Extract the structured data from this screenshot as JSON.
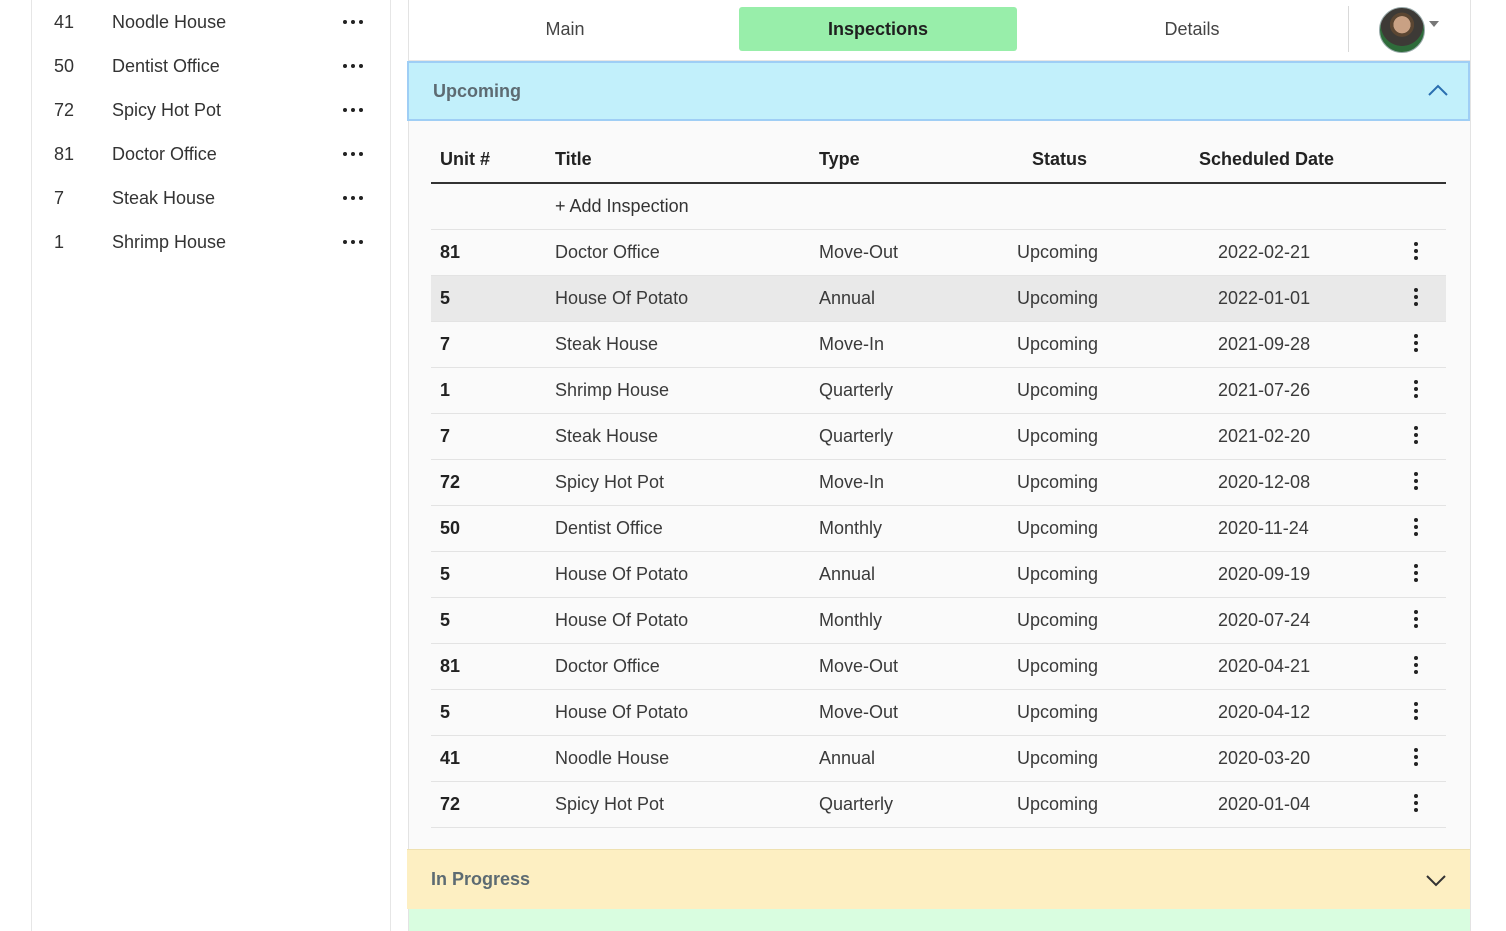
{
  "sidebar": {
    "items": [
      {
        "unit": "41",
        "title": "Noodle House"
      },
      {
        "unit": "50",
        "title": "Dentist Office"
      },
      {
        "unit": "72",
        "title": "Spicy Hot Pot"
      },
      {
        "unit": "81",
        "title": "Doctor Office"
      },
      {
        "unit": "7",
        "title": "Steak House"
      },
      {
        "unit": "1",
        "title": "Shrimp House"
      }
    ]
  },
  "tabs": {
    "main": "Main",
    "inspections": "Inspections",
    "details": "Details"
  },
  "sections": {
    "upcoming": "Upcoming",
    "in_progress": "In Progress"
  },
  "table": {
    "headers": {
      "unit": "Unit #",
      "title": "Title",
      "type": "Type",
      "status": "Status",
      "date": "Scheduled Date"
    },
    "add_label": "+  Add Inspection",
    "rows": [
      {
        "unit": "81",
        "title": "Doctor Office",
        "type": "Move-Out",
        "status": "Upcoming",
        "date": "2022-02-21"
      },
      {
        "unit": "5",
        "title": "House Of Potato",
        "type": "Annual",
        "status": "Upcoming",
        "date": "2022-01-01"
      },
      {
        "unit": "7",
        "title": "Steak House",
        "type": "Move-In",
        "status": "Upcoming",
        "date": "2021-09-28"
      },
      {
        "unit": "1",
        "title": "Shrimp House",
        "type": "Quarterly",
        "status": "Upcoming",
        "date": "2021-07-26"
      },
      {
        "unit": "7",
        "title": "Steak House",
        "type": "Quarterly",
        "status": "Upcoming",
        "date": "2021-02-20"
      },
      {
        "unit": "72",
        "title": "Spicy Hot Pot",
        "type": "Move-In",
        "status": "Upcoming",
        "date": "2020-12-08"
      },
      {
        "unit": "50",
        "title": "Dentist Office",
        "type": "Monthly",
        "status": "Upcoming",
        "date": "2020-11-24"
      },
      {
        "unit": "5",
        "title": "House Of Potato",
        "type": "Annual",
        "status": "Upcoming",
        "date": "2020-09-19"
      },
      {
        "unit": "5",
        "title": "House Of Potato",
        "type": "Monthly",
        "status": "Upcoming",
        "date": "2020-07-24"
      },
      {
        "unit": "81",
        "title": "Doctor Office",
        "type": "Move-Out",
        "status": "Upcoming",
        "date": "2020-04-21"
      },
      {
        "unit": "5",
        "title": "House Of Potato",
        "type": "Move-Out",
        "status": "Upcoming",
        "date": "2020-04-12"
      },
      {
        "unit": "41",
        "title": "Noodle House",
        "type": "Annual",
        "status": "Upcoming",
        "date": "2020-03-20"
      },
      {
        "unit": "72",
        "title": "Spicy Hot Pot",
        "type": "Quarterly",
        "status": "Upcoming",
        "date": "2020-01-04"
      }
    ]
  },
  "colors": {
    "active_tab": "#98eeaa",
    "upcoming_header": "#c2f0fb",
    "in_progress_header": "#fdefc2",
    "next_section": "#d9fde0"
  }
}
